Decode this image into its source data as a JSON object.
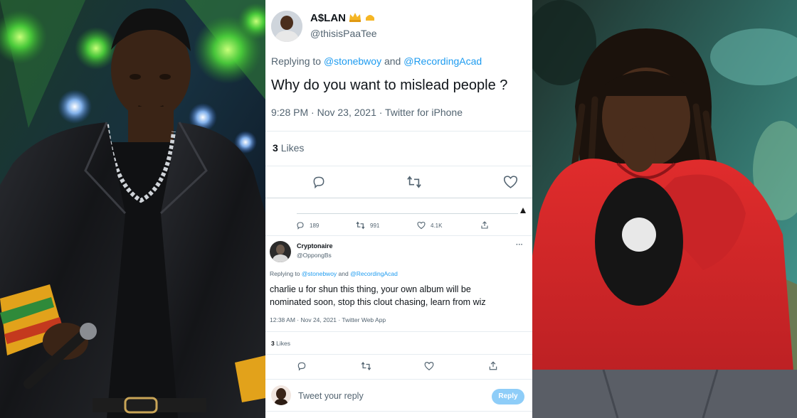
{
  "tweet1": {
    "display_name": "A$LAN",
    "handle": "@thisisPaaTee",
    "replying_prefix": "Replying to",
    "replying_user1": "@stonebwoy",
    "replying_and": "and",
    "replying_user2": "@RecordingAcad",
    "text": "Why do you want to mislead people ?",
    "timestamp": "9:28 PM · Nov 23, 2021 · Twitter for iPhone",
    "likes_count": "3",
    "likes_label": "Likes",
    "icons": [
      "reply-icon",
      "retweet-icon",
      "like-icon"
    ]
  },
  "quoted_stats": {
    "replies": "189",
    "retweets": "991",
    "likes": "4.1K",
    "icons": [
      "reply-icon",
      "retweet-icon",
      "like-icon",
      "share-icon"
    ]
  },
  "tweet2": {
    "display_name": "Cryptonaire",
    "handle": "@OppongBs",
    "more": "···",
    "replying_prefix": "Replying to",
    "replying_user1": "@stonebwoy",
    "replying_and": "and",
    "replying_user2": "@RecordingAcad",
    "text_line1": "charlie u for shun this thing, your own album will be",
    "text_line2": "nominated soon, stop this clout chasing, learn from wiz",
    "timestamp": "12:38 AM · Nov 24, 2021 · Twitter Web App",
    "likes_count": "3",
    "likes_label": "Likes",
    "icons": [
      "reply-icon",
      "retweet-icon",
      "like-icon",
      "share-icon"
    ]
  },
  "composer": {
    "placeholder": "Tweet your reply",
    "reply_label": "Reply"
  },
  "colors": {
    "link": "#1d9bf0",
    "muted": "#536471",
    "text": "#0f1419",
    "reply_button": "#8ecdf8",
    "hoodie_red": "#d3262a"
  }
}
